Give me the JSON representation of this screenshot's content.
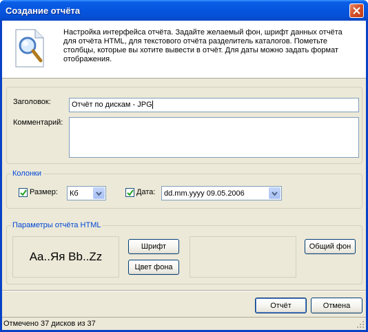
{
  "window": {
    "title": "Создание отчёта",
    "description": "Настройка интерфейса отчёта. Задайте желаемый фон, шрифт данных отчёта для отчёта HTML, для текстового отчёта разделитель каталогов. Пометьте столбцы, которые вы хотите вывести в отчёт. Для даты можно задать формат отображения."
  },
  "form": {
    "header_label": "Заголовок:",
    "header_value": "Отчёт по дискам - JPG",
    "comment_label": "Комментарий:",
    "comment_value": ""
  },
  "columns_group": {
    "title": "Колонки",
    "size_label": "Размер:",
    "size_checked": true,
    "size_unit": "Кб",
    "date_label": "Дата:",
    "date_checked": true,
    "date_format": "dd.mm.yyyy 09.05.2006"
  },
  "html_group": {
    "title": "Параметры отчёта HTML",
    "font_sample": "Aa..Яя Bb..Zz",
    "font_button": "Шрифт",
    "bgcolor_button": "Цвет фона",
    "common_bg_button": "Общий фон"
  },
  "buttons": {
    "ok": "Отчёт",
    "cancel": "Отмена"
  },
  "status": {
    "text": "Отмечено 37 дисков из 37"
  },
  "colors": {
    "titlebar": "#0655df",
    "group_title": "#0046d5",
    "dialog_bg": "#ece9d8"
  }
}
